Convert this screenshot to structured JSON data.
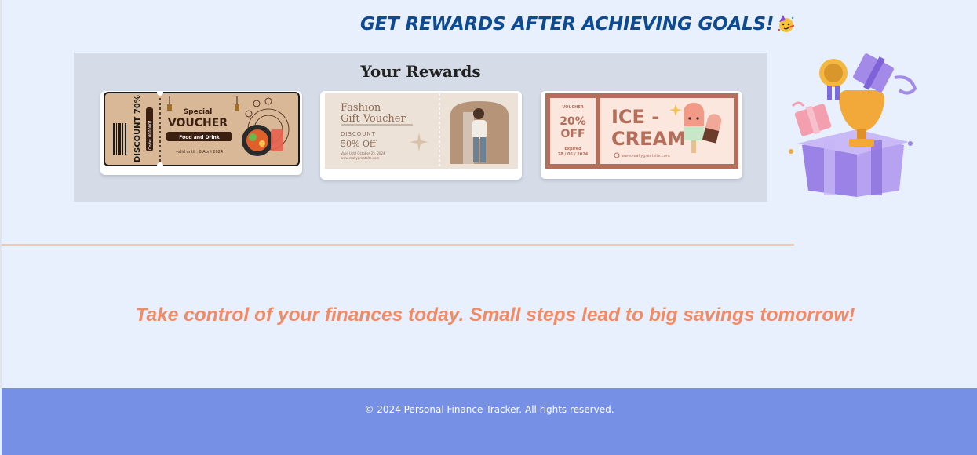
{
  "header": {
    "title": "GET REWARDS AFTER ACHIEVING GOALS!",
    "emoji_icon": "party-face-icon"
  },
  "rewards": {
    "title": "Your Rewards",
    "vouchers": [
      {
        "side_text": "DISCOUNT 70%",
        "code_text": "Code: 0000001",
        "heading": "Special",
        "title": "VOUCHER",
        "tag": "Food and Drink",
        "valid": "valid until : 8 April 2024"
      },
      {
        "title_line1": "Fashion",
        "title_line2": "Gift Voucher",
        "label": "DISCOUNT",
        "value": "50% Off",
        "valid": "Valid Until October 25, 2024",
        "site": "www.reallygreatsite.com"
      },
      {
        "label": "VOUCHER",
        "value_line1": "20%",
        "value_line2": "OFF",
        "expired_label": "Expired",
        "expired_date": "28 / 06 / 2024",
        "title_line1": "ICE -",
        "title_line2": "CREAM",
        "site": "www.reallygreatsite.com"
      }
    ]
  },
  "tagline": "Take control of your finances today. Small steps lead to big savings tomorrow!",
  "footer": {
    "text": "© 2024 Personal Finance Tracker. All rights reserved."
  },
  "colors": {
    "background": "#e8effd",
    "headline": "#0d4a8f",
    "panel": "#d5dce8",
    "tagline": "#f28a63",
    "footer": "#7590e4",
    "divider": "#f3c9a9"
  }
}
